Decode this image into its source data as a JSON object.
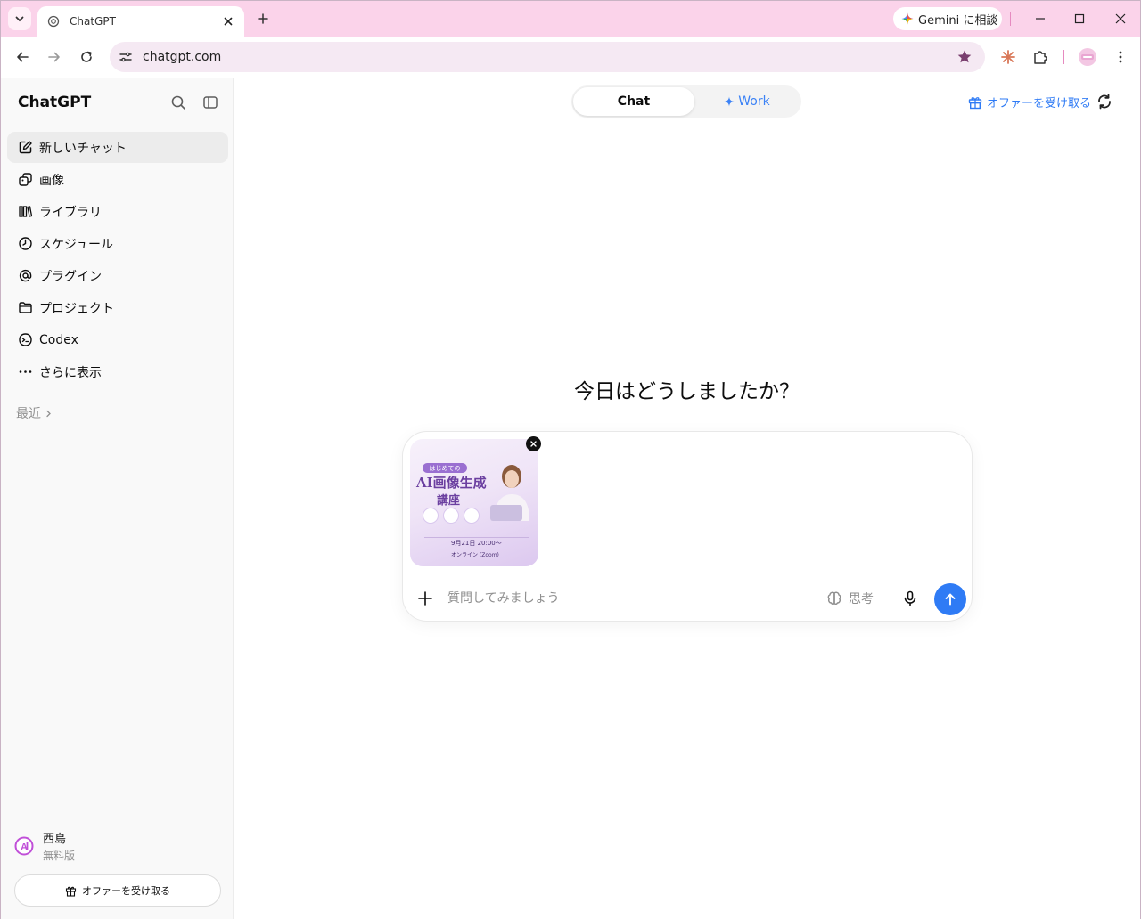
{
  "browser": {
    "tab_title": "ChatGPT",
    "gemini_label": "Gemini に相談",
    "url": "chatgpt.com"
  },
  "sidebar": {
    "title": "ChatGPT",
    "items": [
      {
        "label": "新しいチャット",
        "icon": "edit-icon"
      },
      {
        "label": "画像",
        "icon": "images-icon"
      },
      {
        "label": "ライブラリ",
        "icon": "library-icon"
      },
      {
        "label": "スケジュール",
        "icon": "clock-icon"
      },
      {
        "label": "プラグイン",
        "icon": "at-icon"
      },
      {
        "label": "プロジェクト",
        "icon": "folder-icon"
      },
      {
        "label": "Codex",
        "icon": "codex-icon"
      },
      {
        "label": "さらに表示",
        "icon": "more-icon"
      }
    ],
    "recent_label": "最近",
    "user_name": "西島",
    "user_plan": "無料版",
    "offer_label": "オファーを受け取る"
  },
  "main": {
    "mode_chat": "Chat",
    "mode_work": "Work",
    "offer_link": "オファーを受け取る",
    "greeting": "今日はどうしましたか？",
    "composer": {
      "placeholder": "質問してみましょう",
      "think_label": "思考"
    },
    "attachment": {
      "title": "AI画像生成",
      "subtitle": "講座",
      "badge": "はじめての",
      "date": "9月21日 20:00〜",
      "place": "オンライン (Zoom)"
    }
  },
  "colors": {
    "accent": "#2f7bf5",
    "tabstrip": "#fbd3ea"
  }
}
